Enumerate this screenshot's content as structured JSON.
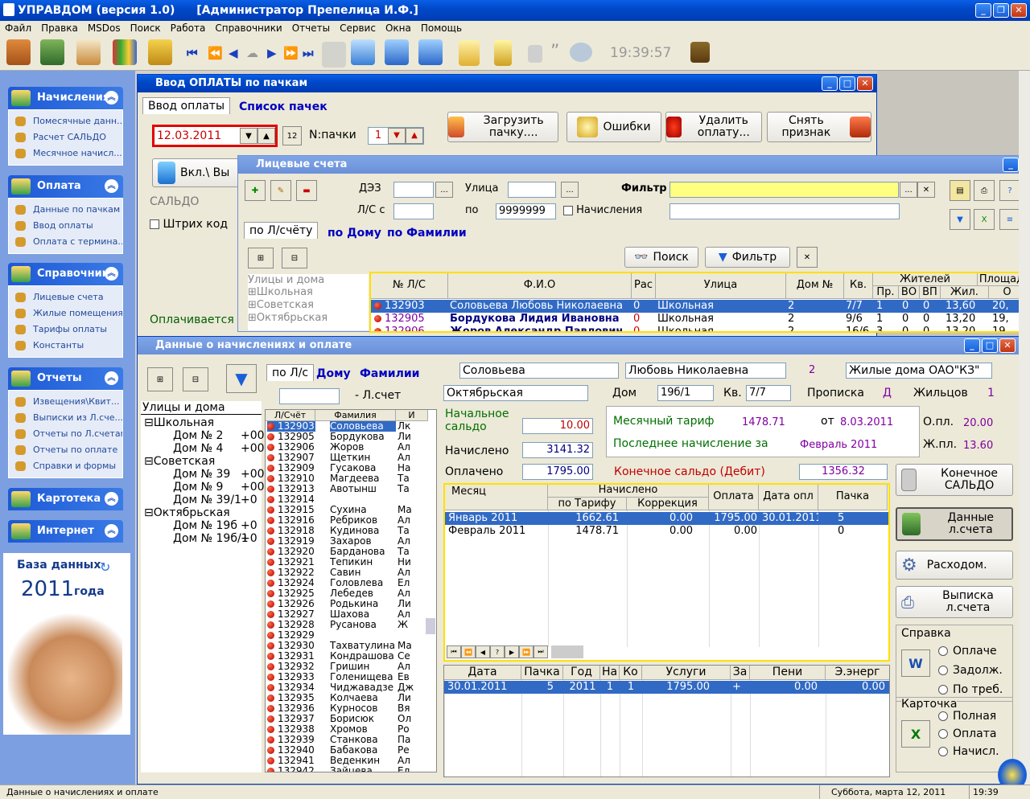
{
  "app": {
    "title": "УПРАВДОМ (версия 1.0)",
    "user": "[Администратор Препелица И.Ф.]"
  },
  "menu": [
    "Файл",
    "Правка",
    "MSDos",
    "Поиск",
    "Работа",
    "Справочники",
    "Отчеты",
    "Сервис",
    "Окна",
    "Помощь"
  ],
  "toolbar": {
    "clock": "19:39:57",
    "quote_glyph": "”"
  },
  "sidebar": {
    "groups": [
      {
        "title": "Начисления",
        "items": [
          "Помесячные данн...",
          "Расчет САЛЬДО",
          "Месячное начисл..."
        ]
      },
      {
        "title": "Оплата",
        "items": [
          "Данные по пачкам",
          "Ввод оплаты",
          "Оплата с термина..."
        ]
      },
      {
        "title": "Справочники",
        "items": [
          "Лицевые счета",
          "Жилые помещения",
          "Тарифы оплаты",
          "Константы"
        ]
      },
      {
        "title": "Отчеты",
        "items": [
          "Извещения\\Квит...",
          "Выписки из Л.сче...",
          "Отчеты по Л.счетам",
          "Отчеты по оплате",
          "Справки и формы"
        ]
      },
      {
        "title": "Картотека",
        "items": []
      },
      {
        "title": "Интернет",
        "items": []
      }
    ],
    "db_label": "База данных",
    "db_year": "2011",
    "db_suffix": "года"
  },
  "payment": {
    "title": "Ввод ОПЛАТЫ по пачкам",
    "tab_input": "Ввод оплаты",
    "tab_list": "Список пачек",
    "date": "12.03.2011",
    "pack_label": "N:пачки",
    "pack_value": "1",
    "load_btn": "Загрузить пачку....",
    "errors_btn": "Ошибки",
    "delete_btn": "Удалить оплату...",
    "unmark_btn": "Снять признак",
    "incl_btn": "Вкл.\\ Вы",
    "saldo_label": "САЛЬДО",
    "barcode_label": "Штрих код",
    "paying_label": "Оплачивается"
  },
  "accounts": {
    "title": "Лицевые счета",
    "dez_label": "ДЭЗ",
    "street_label": "Улица",
    "filter_label": "Фильтр",
    "ls_from_label": "Л/С с",
    "ls_to_label": "по",
    "ls_to_value": "9999999",
    "charges_label": "Начисления",
    "tab_ls": "по Л/счёту",
    "tab_house": "по Дому",
    "tab_name": "по Фамилии",
    "search_btn": "Поиск",
    "filter_btn": "Фильтр",
    "tree_title": "Улицы и дома",
    "tree": [
      "Школьная",
      "Советская",
      "Октябрьская"
    ],
    "headers": [
      "№ Л/С",
      "Ф.И.О",
      "Рас",
      "Улица",
      "Дом №",
      "Кв.",
      "Жителей",
      "Площад"
    ],
    "sub_headers": [
      "Пр.",
      "ВО",
      "ВП",
      "Жил.",
      "О"
    ],
    "rows": [
      {
        "ls": "132903",
        "fio": "Соловьева Любовь Николаевна",
        "ras": "0",
        "street": "Школьная",
        "house": "2",
        "kv": "7/7",
        "pr": "1",
        "vo": "0",
        "vp": "0",
        "zh": "13,60",
        "o": "20,"
      },
      {
        "ls": "132905",
        "fio": "Бордукова Лидия Ивановна",
        "ras": "0",
        "street": "Школьная",
        "house": "2",
        "kv": "9/6",
        "pr": "1",
        "vo": "0",
        "vp": "0",
        "zh": "13,20",
        "o": "19,"
      },
      {
        "ls": "132906",
        "fio": "Жоров Александр Павлович",
        "ras": "0",
        "street": "Школьная",
        "house": "2",
        "kv": "16/6",
        "pr": "3",
        "vo": "0",
        "vp": "0",
        "zh": "13,20",
        "o": "19,"
      }
    ]
  },
  "details": {
    "title": "Данные о начислениях и оплате",
    "tab_ls": "по Л/с",
    "tab_house": "Дому",
    "tab_name": "Фамилии",
    "ls_suffix": "- Л.счет",
    "tree_title": "Улицы и дома",
    "tree": [
      {
        "label": "Школьная",
        "children": [
          {
            "label": "Дом № 2",
            "v": "+00"
          },
          {
            "label": "Дом № 4",
            "v": "+00"
          }
        ]
      },
      {
        "label": "Советская",
        "children": [
          {
            "label": "Дом № 39",
            "v": "+00"
          },
          {
            "label": "Дом № 9",
            "v": "+00"
          },
          {
            "label": "Дом № 39/1",
            "v": "+0"
          }
        ]
      },
      {
        "label": "Октябрьская",
        "children": [
          {
            "label": "Дом № 19б",
            "v": "+0"
          },
          {
            "label": "Дом № 19б/1",
            "v": "+0"
          }
        ]
      }
    ],
    "list_headers": [
      "Л/Счёт",
      "Фамилия",
      "И"
    ],
    "list": [
      [
        "132903",
        "Соловьева",
        "Лк"
      ],
      [
        "132905",
        "Бордукова",
        "Ли"
      ],
      [
        "132906",
        "Жоров",
        "Ал"
      ],
      [
        "132907",
        "Щеткин",
        "Ал"
      ],
      [
        "132909",
        "Гусакова",
        "На"
      ],
      [
        "132910",
        "Магдеева",
        "Та"
      ],
      [
        "132913",
        "Авотынш",
        "Та"
      ],
      [
        "132914",
        "",
        ""
      ],
      [
        "132915",
        "Сухина",
        "Ма"
      ],
      [
        "132916",
        "Ребриков",
        "Ал"
      ],
      [
        "132918",
        "Кудинова",
        "Та"
      ],
      [
        "132919",
        "Захаров",
        "Ал"
      ],
      [
        "132920",
        "Барданова",
        "Та"
      ],
      [
        "132921",
        "Тепикин",
        "Ни"
      ],
      [
        "132922",
        "Савин",
        "Ал"
      ],
      [
        "132924",
        "Головлева",
        "Ел"
      ],
      [
        "132925",
        "Лебедев",
        "Ал"
      ],
      [
        "132926",
        "Родькина",
        "Ли"
      ],
      [
        "132927",
        "Шахова",
        "Ал"
      ],
      [
        "132928",
        "Русанова",
        "Ж"
      ],
      [
        "132929",
        "",
        ""
      ],
      [
        "132930",
        "Тахватулина",
        "Ма"
      ],
      [
        "132931",
        "Кондрашова",
        "Се"
      ],
      [
        "132932",
        "Гришин",
        "Ал"
      ],
      [
        "132933",
        "Голенищева",
        "Ев"
      ],
      [
        "132934",
        "Чиджавадзе",
        "Дж"
      ],
      [
        "132935",
        "Колчаева",
        "Ли"
      ],
      [
        "132936",
        "Курносов",
        "Вя"
      ],
      [
        "132937",
        "Борисюк",
        "Ол"
      ],
      [
        "132938",
        "Хромов",
        "Ро"
      ],
      [
        "132939",
        "Станкова",
        "Па"
      ],
      [
        "132940",
        "Бабакова",
        "Ре"
      ],
      [
        "132941",
        "Веденкин",
        "Ал"
      ],
      [
        "132942",
        "Зайцева",
        "Ел"
      ]
    ],
    "surname": "Соловьева",
    "name": "Любовь Николаевна",
    "name_num": "2",
    "org": "Жилые дома ОАО\"КЗ\"",
    "street": "Октябрьская",
    "house_label": "Дом",
    "house": "19б/1",
    "kv_label": "Кв.",
    "kv": "7/7",
    "reg_label": "Прописка",
    "reg": "Д",
    "residents_label": "Жильцов",
    "residents": "1",
    "start_saldo_label": "Начальное сальдо",
    "start_saldo": "10.00",
    "charged_label": "Начислено",
    "charged": "3141.32",
    "paid_label": "Оплачено",
    "paid": "1795.00",
    "tariff_label": "Месячный тариф",
    "tariff": "1478.71",
    "tariff_from_label": "от",
    "tariff_from": "8.03.2011",
    "last_label": "Последнее начисление за",
    "last": "Февраль 2011",
    "area_total_label": "О.пл.",
    "area_total": "20.00",
    "area_live_label": "Ж.пл.",
    "area_live": "13.60",
    "end_saldo_label": "Конечное сальдо (Дебит)",
    "end_saldo": "1356.32",
    "month_headers": [
      "Месяц",
      "Начислено",
      "Оплата",
      "Дата опл",
      "Пачка"
    ],
    "month_sub": [
      "по Тарифу",
      "Коррекция"
    ],
    "months": [
      {
        "m": "Январь 2011",
        "t": "1662.61",
        "c": "0.00",
        "p": "1795.00",
        "d": "30.01.2011",
        "pk": "5"
      },
      {
        "m": "Февраль 2011",
        "t": "1478.71",
        "c": "0.00",
        "p": "0.00",
        "d": "",
        "pk": "0"
      }
    ],
    "nav_question": "?",
    "pay_headers": [
      "Дата",
      "Пачка",
      "Год",
      "На",
      "Ко",
      "Услуги",
      "За",
      "Пени",
      "Э.энерг"
    ],
    "payments": [
      {
        "d": "30.01.2011",
        "pk": "5",
        "y": "2011",
        "na": "1",
        "ko": "1",
        "s": "1795.00",
        "za": "+",
        "p": "0.00",
        "e": "0.00"
      }
    ],
    "btn_end_saldo": "Конечное САЛЬДО",
    "btn_ls_data": "Данные л.счета",
    "btn_expense": "Расходом.",
    "btn_statement": "Выписка л.счета",
    "help_label": "Справка",
    "help_opts": [
      "Оплаче",
      "Задолж.",
      "По треб."
    ],
    "card_label": "Карточка",
    "card_opts": [
      "Полная",
      "Оплата",
      "Начисл."
    ]
  },
  "status": {
    "left": "Данные о начислениях и оплате",
    "date": "Суббота, марта 12, 2011",
    "time": "19:39"
  }
}
